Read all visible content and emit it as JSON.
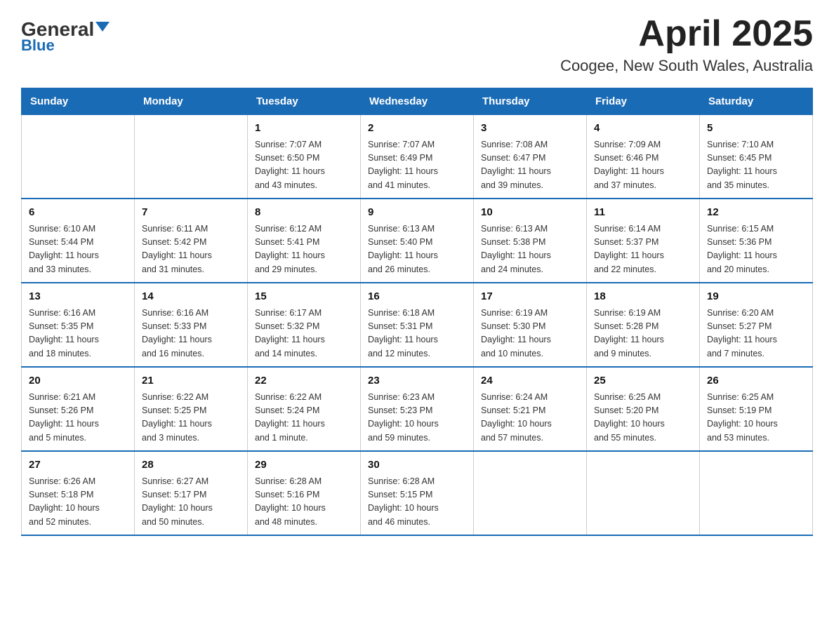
{
  "header": {
    "logo_black": "General",
    "logo_blue": "Blue",
    "title": "April 2025",
    "subtitle": "Coogee, New South Wales, Australia"
  },
  "weekdays": [
    "Sunday",
    "Monday",
    "Tuesday",
    "Wednesday",
    "Thursday",
    "Friday",
    "Saturday"
  ],
  "weeks": [
    [
      {
        "day": "",
        "info": ""
      },
      {
        "day": "",
        "info": ""
      },
      {
        "day": "1",
        "info": "Sunrise: 7:07 AM\nSunset: 6:50 PM\nDaylight: 11 hours\nand 43 minutes."
      },
      {
        "day": "2",
        "info": "Sunrise: 7:07 AM\nSunset: 6:49 PM\nDaylight: 11 hours\nand 41 minutes."
      },
      {
        "day": "3",
        "info": "Sunrise: 7:08 AM\nSunset: 6:47 PM\nDaylight: 11 hours\nand 39 minutes."
      },
      {
        "day": "4",
        "info": "Sunrise: 7:09 AM\nSunset: 6:46 PM\nDaylight: 11 hours\nand 37 minutes."
      },
      {
        "day": "5",
        "info": "Sunrise: 7:10 AM\nSunset: 6:45 PM\nDaylight: 11 hours\nand 35 minutes."
      }
    ],
    [
      {
        "day": "6",
        "info": "Sunrise: 6:10 AM\nSunset: 5:44 PM\nDaylight: 11 hours\nand 33 minutes."
      },
      {
        "day": "7",
        "info": "Sunrise: 6:11 AM\nSunset: 5:42 PM\nDaylight: 11 hours\nand 31 minutes."
      },
      {
        "day": "8",
        "info": "Sunrise: 6:12 AM\nSunset: 5:41 PM\nDaylight: 11 hours\nand 29 minutes."
      },
      {
        "day": "9",
        "info": "Sunrise: 6:13 AM\nSunset: 5:40 PM\nDaylight: 11 hours\nand 26 minutes."
      },
      {
        "day": "10",
        "info": "Sunrise: 6:13 AM\nSunset: 5:38 PM\nDaylight: 11 hours\nand 24 minutes."
      },
      {
        "day": "11",
        "info": "Sunrise: 6:14 AM\nSunset: 5:37 PM\nDaylight: 11 hours\nand 22 minutes."
      },
      {
        "day": "12",
        "info": "Sunrise: 6:15 AM\nSunset: 5:36 PM\nDaylight: 11 hours\nand 20 minutes."
      }
    ],
    [
      {
        "day": "13",
        "info": "Sunrise: 6:16 AM\nSunset: 5:35 PM\nDaylight: 11 hours\nand 18 minutes."
      },
      {
        "day": "14",
        "info": "Sunrise: 6:16 AM\nSunset: 5:33 PM\nDaylight: 11 hours\nand 16 minutes."
      },
      {
        "day": "15",
        "info": "Sunrise: 6:17 AM\nSunset: 5:32 PM\nDaylight: 11 hours\nand 14 minutes."
      },
      {
        "day": "16",
        "info": "Sunrise: 6:18 AM\nSunset: 5:31 PM\nDaylight: 11 hours\nand 12 minutes."
      },
      {
        "day": "17",
        "info": "Sunrise: 6:19 AM\nSunset: 5:30 PM\nDaylight: 11 hours\nand 10 minutes."
      },
      {
        "day": "18",
        "info": "Sunrise: 6:19 AM\nSunset: 5:28 PM\nDaylight: 11 hours\nand 9 minutes."
      },
      {
        "day": "19",
        "info": "Sunrise: 6:20 AM\nSunset: 5:27 PM\nDaylight: 11 hours\nand 7 minutes."
      }
    ],
    [
      {
        "day": "20",
        "info": "Sunrise: 6:21 AM\nSunset: 5:26 PM\nDaylight: 11 hours\nand 5 minutes."
      },
      {
        "day": "21",
        "info": "Sunrise: 6:22 AM\nSunset: 5:25 PM\nDaylight: 11 hours\nand 3 minutes."
      },
      {
        "day": "22",
        "info": "Sunrise: 6:22 AM\nSunset: 5:24 PM\nDaylight: 11 hours\nand 1 minute."
      },
      {
        "day": "23",
        "info": "Sunrise: 6:23 AM\nSunset: 5:23 PM\nDaylight: 10 hours\nand 59 minutes."
      },
      {
        "day": "24",
        "info": "Sunrise: 6:24 AM\nSunset: 5:21 PM\nDaylight: 10 hours\nand 57 minutes."
      },
      {
        "day": "25",
        "info": "Sunrise: 6:25 AM\nSunset: 5:20 PM\nDaylight: 10 hours\nand 55 minutes."
      },
      {
        "day": "26",
        "info": "Sunrise: 6:25 AM\nSunset: 5:19 PM\nDaylight: 10 hours\nand 53 minutes."
      }
    ],
    [
      {
        "day": "27",
        "info": "Sunrise: 6:26 AM\nSunset: 5:18 PM\nDaylight: 10 hours\nand 52 minutes."
      },
      {
        "day": "28",
        "info": "Sunrise: 6:27 AM\nSunset: 5:17 PM\nDaylight: 10 hours\nand 50 minutes."
      },
      {
        "day": "29",
        "info": "Sunrise: 6:28 AM\nSunset: 5:16 PM\nDaylight: 10 hours\nand 48 minutes."
      },
      {
        "day": "30",
        "info": "Sunrise: 6:28 AM\nSunset: 5:15 PM\nDaylight: 10 hours\nand 46 minutes."
      },
      {
        "day": "",
        "info": ""
      },
      {
        "day": "",
        "info": ""
      },
      {
        "day": "",
        "info": ""
      }
    ]
  ]
}
